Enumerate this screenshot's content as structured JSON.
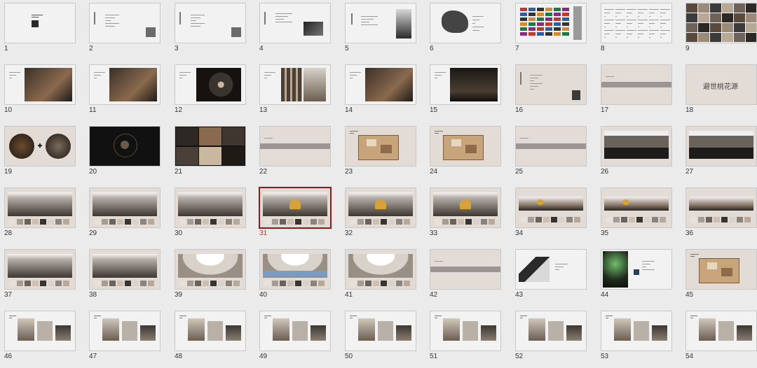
{
  "app": {
    "view": "slide-sorter"
  },
  "selection": {
    "selected_slide": "31",
    "accent_color": "#8b1a1a"
  },
  "colors": {
    "background": "#ebebeb",
    "slide_white": "#f2f2f2",
    "slide_beige": "#e2dbd6",
    "slide_dark": "#111111",
    "photo_dark": "#3b2f27",
    "photo_warm": "#8a6a4e",
    "accent_gold": "#d8a23a",
    "china_map": "#444444"
  },
  "slides": [
    {
      "number": "1",
      "kind": "title-white"
    },
    {
      "number": "2",
      "kind": "text-white"
    },
    {
      "number": "3",
      "kind": "text-white"
    },
    {
      "number": "4",
      "kind": "text-white-photo"
    },
    {
      "number": "5",
      "kind": "portrait"
    },
    {
      "number": "6",
      "kind": "map"
    },
    {
      "number": "7",
      "kind": "logos"
    },
    {
      "number": "8",
      "kind": "text-columns"
    },
    {
      "number": "9",
      "kind": "photo-collage"
    },
    {
      "number": "10",
      "kind": "photo-interior"
    },
    {
      "number": "11",
      "kind": "photo-interior"
    },
    {
      "number": "12",
      "kind": "photo-stair"
    },
    {
      "number": "13",
      "kind": "photo-columns"
    },
    {
      "number": "14",
      "kind": "photo-interior"
    },
    {
      "number": "15",
      "kind": "photo-dark"
    },
    {
      "number": "16",
      "kind": "beige-text"
    },
    {
      "number": "17",
      "kind": "beige-band"
    },
    {
      "number": "18",
      "kind": "title-beige",
      "title": "避世桃花源"
    },
    {
      "number": "19",
      "kind": "circles"
    },
    {
      "number": "20",
      "kind": "dark-circles"
    },
    {
      "number": "21",
      "kind": "photo-collage-dark"
    },
    {
      "number": "22",
      "kind": "beige-band"
    },
    {
      "number": "23",
      "kind": "floor-plan"
    },
    {
      "number": "24",
      "kind": "floor-plan"
    },
    {
      "number": "25",
      "kind": "beige-band"
    },
    {
      "number": "26",
      "kind": "render-hall"
    },
    {
      "number": "27",
      "kind": "render-hall"
    },
    {
      "number": "28",
      "kind": "render-materials"
    },
    {
      "number": "29",
      "kind": "render-materials"
    },
    {
      "number": "30",
      "kind": "render-materials"
    },
    {
      "number": "31",
      "kind": "render-materials"
    },
    {
      "number": "32",
      "kind": "render-materials"
    },
    {
      "number": "33",
      "kind": "render-materials"
    },
    {
      "number": "34",
      "kind": "render-strip"
    },
    {
      "number": "35",
      "kind": "render-strip"
    },
    {
      "number": "36",
      "kind": "render-strip"
    },
    {
      "number": "37",
      "kind": "render-materials"
    },
    {
      "number": "38",
      "kind": "render-materials"
    },
    {
      "number": "39",
      "kind": "render-arches"
    },
    {
      "number": "40",
      "kind": "render-arches"
    },
    {
      "number": "41",
      "kind": "render-arches"
    },
    {
      "number": "42",
      "kind": "beige-band"
    },
    {
      "number": "43",
      "kind": "photo-stair-text"
    },
    {
      "number": "44",
      "kind": "photo-plant"
    },
    {
      "number": "45",
      "kind": "floor-plan"
    },
    {
      "number": "46",
      "kind": "furniture"
    },
    {
      "number": "47",
      "kind": "furniture"
    },
    {
      "number": "48",
      "kind": "furniture"
    },
    {
      "number": "49",
      "kind": "furniture"
    },
    {
      "number": "50",
      "kind": "furniture"
    },
    {
      "number": "51",
      "kind": "furniture"
    },
    {
      "number": "52",
      "kind": "furniture"
    },
    {
      "number": "53",
      "kind": "furniture"
    },
    {
      "number": "54",
      "kind": "furniture"
    }
  ]
}
